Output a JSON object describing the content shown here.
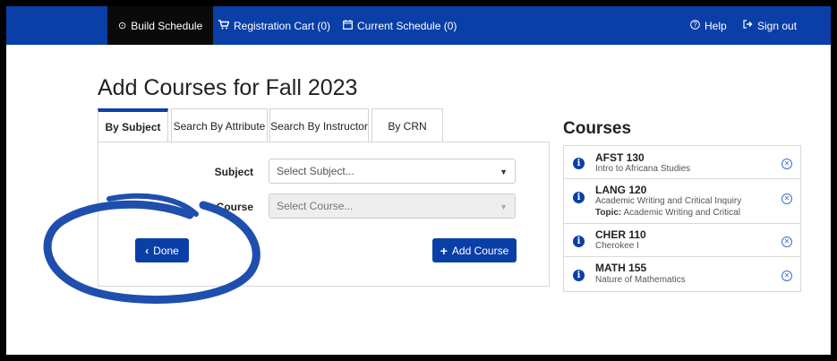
{
  "nav": {
    "build_schedule": "Build Schedule",
    "registration_cart": "Registration Cart (0)",
    "current_schedule": "Current Schedule (0)",
    "help": "Help",
    "sign_out": "Sign out"
  },
  "page_title": "Add Courses for Fall 2023",
  "tabs": [
    "By Subject",
    "Search By Attribute",
    "Search By Instructor",
    "By CRN"
  ],
  "form": {
    "subject_label": "Subject",
    "subject_placeholder": "Select Subject...",
    "course_label": "Course",
    "course_placeholder": "Select Course...",
    "done_label": "Done",
    "add_course_label": "Add Course"
  },
  "courses": {
    "title": "Courses",
    "items": [
      {
        "code": "AFST 130",
        "name": "Intro to Africana Studies"
      },
      {
        "code": "LANG 120",
        "name": "Academic Writing and Critical Inquiry",
        "topic_label": "Topic:",
        "topic": "Academic Writing and Critical"
      },
      {
        "code": "CHER 110",
        "name": "Cherokee I"
      },
      {
        "code": "MATH 155",
        "name": "Nature of Mathematics"
      }
    ]
  },
  "colors": {
    "brand_blue": "#0a3fa8",
    "annotation": "#1f4fae"
  },
  "icons": {
    "build": "clock-circle-icon",
    "cart": "cart-icon",
    "calendar": "calendar-icon",
    "help": "question-circle-icon",
    "signout": "signout-icon",
    "info": "info-circle-icon",
    "remove": "remove-circle-icon"
  }
}
